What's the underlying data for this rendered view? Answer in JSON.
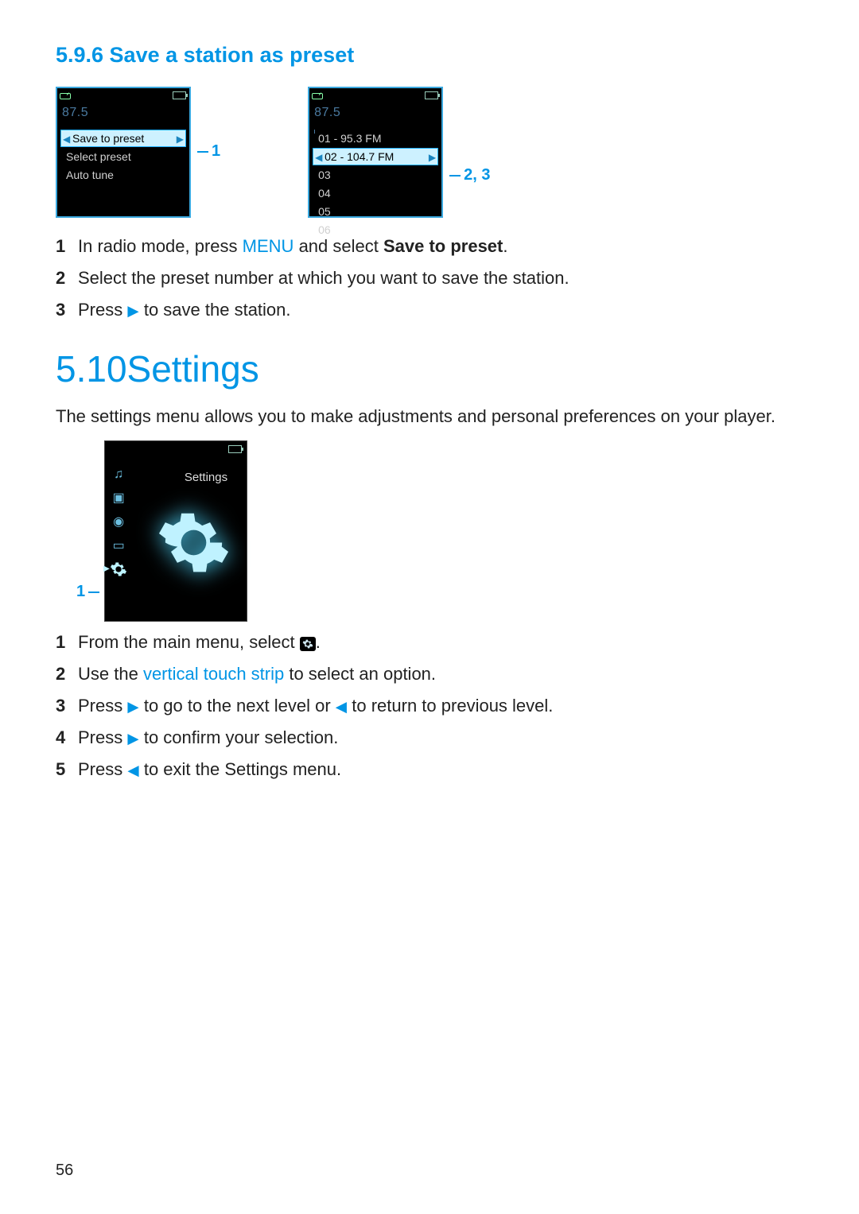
{
  "section596": {
    "heading": "5.9.6 Save a station as preset",
    "freq": "87.5",
    "screenA": {
      "items": [
        "Save to preset",
        "Select preset",
        "Auto tune"
      ],
      "highlight_index": 0,
      "callout": "1"
    },
    "screenB": {
      "items": [
        "01 - 95.3 FM",
        "02 - 104.7 FM",
        "03",
        "04",
        "05",
        "06"
      ],
      "highlight_index": 1,
      "callout": "2, 3"
    },
    "steps": {
      "s1_a": "In radio mode, press ",
      "s1_menu": "MENU",
      "s1_b": " and select ",
      "s1_bold": "Save to preset",
      "s1_c": ".",
      "s2": "Select the preset number at which you want to save the station.",
      "s3_a": "Press ",
      "s3_b": " to save the station."
    }
  },
  "section510": {
    "heading": "5.10Settings",
    "intro": "The settings menu allows you to make adjustments and personal preferences on your player.",
    "screen_title": "Settings",
    "callout": "1",
    "steps": {
      "s1": "From the main menu, select ",
      "s1_end": ".",
      "s2_a": "Use the ",
      "s2_link": "vertical touch strip",
      "s2_b": " to select an option.",
      "s3_a": "Press ",
      "s3_b": " to go to the next level or ",
      "s3_c": " to return to previous level.",
      "s4_a": "Press ",
      "s4_b": " to confirm your selection.",
      "s5_a": "Press ",
      "s5_b": " to exit the Settings menu."
    }
  },
  "glyphs": {
    "play_right": "▶",
    "play_left": "◀"
  },
  "page_number": "56"
}
